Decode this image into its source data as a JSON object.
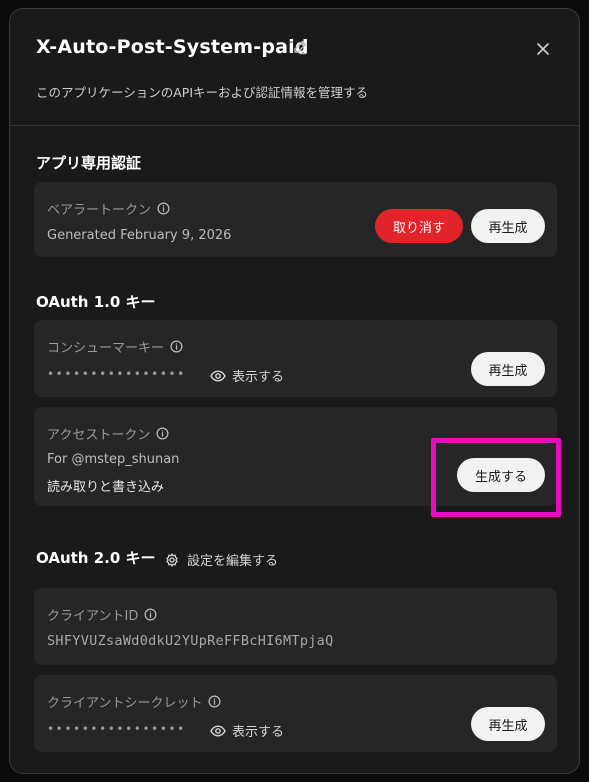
{
  "header": {
    "title": "X-Auto-Post-System-paid",
    "subtitle": "このアプリケーションのAPIキーおよび認証情報を管理する"
  },
  "app_auth": {
    "section_title": "アプリ専用認証",
    "bearer": {
      "label": "ベアラートークン",
      "generated": "Generated February 9, 2026",
      "revoke_label": "取り消す",
      "regenerate_label": "再生成"
    }
  },
  "oauth1": {
    "section_title": "OAuth 1.0 キー",
    "consumer": {
      "label": "コンシューマーキー",
      "masked": "••••••••••••••••",
      "show_label": "表示する",
      "regenerate_label": "再生成"
    },
    "access": {
      "label": "アクセストークン",
      "for_user": "For @mstep_shunan",
      "permission": "読み取りと書き込み",
      "generate_label": "生成する"
    }
  },
  "oauth2": {
    "section_title": "OAuth 2.0 キー",
    "edit_settings_label": "設定を編集する",
    "client_id": {
      "label": "クライアントID",
      "value": "SHFYVUZsaWd0dkU2YUpReFFBcHI6MTpjaQ"
    },
    "client_secret": {
      "label": "クライアントシークレット",
      "masked": "••••••••••••••••",
      "show_label": "表示する",
      "regenerate_label": "再生成"
    }
  },
  "colors": {
    "accent_red": "#e0242a",
    "highlight": "#e60cc2"
  }
}
